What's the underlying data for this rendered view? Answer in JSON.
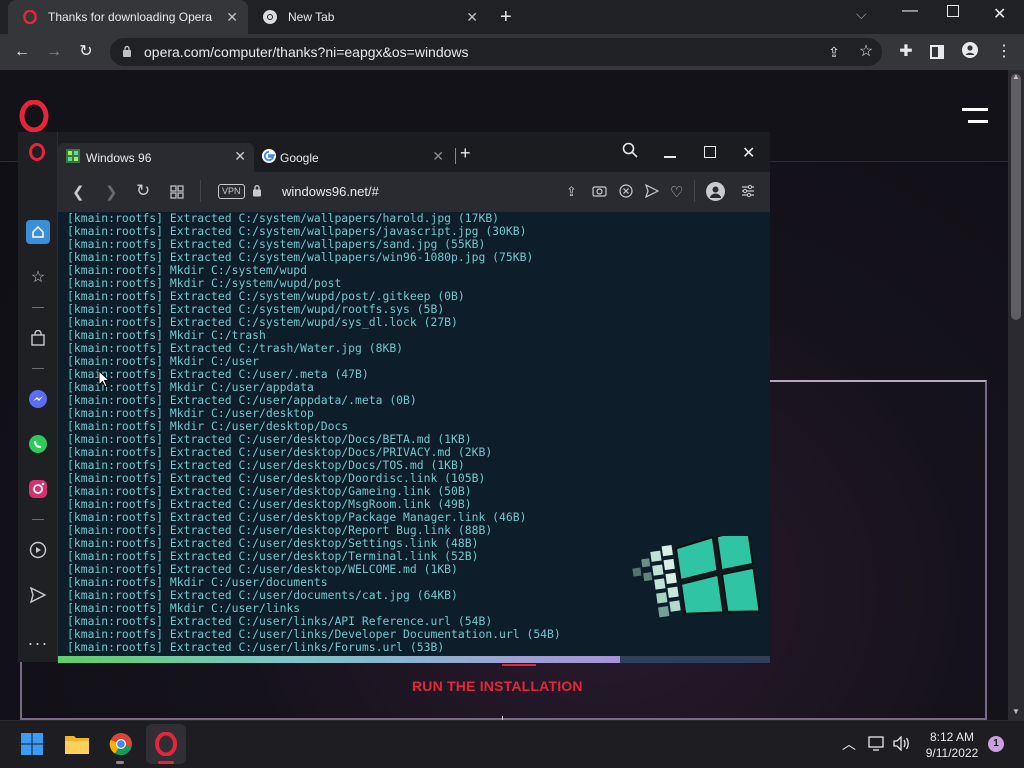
{
  "browser": {
    "tabs": [
      {
        "title": "Thanks for downloading Opera",
        "icon": "opera-icon",
        "active": true
      },
      {
        "title": "New Tab",
        "icon": "chrome-icon",
        "active": false
      }
    ],
    "new_tab_symbol": "+",
    "url": "opera.com/computer/thanks?ni=eapgx&os=windows",
    "window_controls": [
      "minimize",
      "restore",
      "close"
    ]
  },
  "page": {
    "run_label": "RUN THE INSTALLATION"
  },
  "opera": {
    "tabs": [
      {
        "title": "Windows 96",
        "icon": "windows96-icon"
      },
      {
        "title": "Google",
        "icon": "google-icon"
      }
    ],
    "vpn_label": "VPN",
    "url": "windows96.net/#",
    "progress": 0.79
  },
  "terminal": {
    "lines": [
      "[kmain:rootfs] Extracted C:/system/wallpapers/harold.jpg (17KB)",
      "[kmain:rootfs] Extracted C:/system/wallpapers/javascript.jpg (30KB)",
      "[kmain:rootfs] Extracted C:/system/wallpapers/sand.jpg (55KB)",
      "[kmain:rootfs] Extracted C:/system/wallpapers/win96-1080p.jpg (75KB)",
      "[kmain:rootfs] Mkdir C:/system/wupd",
      "[kmain:rootfs] Mkdir C:/system/wupd/post",
      "[kmain:rootfs] Extracted C:/system/wupd/post/.gitkeep (0B)",
      "[kmain:rootfs] Extracted C:/system/wupd/rootfs.sys (5B)",
      "[kmain:rootfs] Extracted C:/system/wupd/sys_dl.lock (27B)",
      "[kmain:rootfs] Mkdir C:/trash",
      "[kmain:rootfs] Extracted C:/trash/Water.jpg (8KB)",
      "[kmain:rootfs] Mkdir C:/user",
      "[kmain:rootfs] Extracted C:/user/.meta (47B)",
      "[kmain:rootfs] Mkdir C:/user/appdata",
      "[kmain:rootfs] Extracted C:/user/appdata/.meta (0B)",
      "[kmain:rootfs] Mkdir C:/user/desktop",
      "[kmain:rootfs] Mkdir C:/user/desktop/Docs",
      "[kmain:rootfs] Extracted C:/user/desktop/Docs/BETA.md (1KB)",
      "[kmain:rootfs] Extracted C:/user/desktop/Docs/PRIVACY.md (2KB)",
      "[kmain:rootfs] Extracted C:/user/desktop/Docs/TOS.md (1KB)",
      "[kmain:rootfs] Extracted C:/user/desktop/Doordisc.link (105B)",
      "[kmain:rootfs] Extracted C:/user/desktop/Gameing.link (50B)",
      "[kmain:rootfs] Extracted C:/user/desktop/MsgRoom.link (49B)",
      "[kmain:rootfs] Extracted C:/user/desktop/Package Manager.link (46B)",
      "[kmain:rootfs] Extracted C:/user/desktop/Report Bug.link (88B)",
      "[kmain:rootfs] Extracted C:/user/desktop/Settings.link (48B)",
      "[kmain:rootfs] Extracted C:/user/desktop/Terminal.link (52B)",
      "[kmain:rootfs] Extracted C:/user/desktop/WELCOME.md (1KB)",
      "[kmain:rootfs] Mkdir C:/user/documents",
      "[kmain:rootfs] Extracted C:/user/documents/cat.jpg (64KB)",
      "[kmain:rootfs] Mkdir C:/user/links",
      "[kmain:rootfs] Extracted C:/user/links/API Reference.url (54B)",
      "[kmain:rootfs] Extracted C:/user/links/Developer Documentation.url (54B)",
      "[kmain:rootfs] Extracted C:/user/links/Forums.url (53B)"
    ]
  },
  "taskbar": {
    "time": "8:12 AM",
    "date": "9/11/2022",
    "notification_count": "1",
    "apps": [
      "windows-start-icon",
      "file-explorer-icon",
      "chrome-icon",
      "opera-icon"
    ]
  },
  "colors": {
    "opera_red": "#e5253a",
    "terminal_text": "#6fc9cf",
    "terminal_bg": "#0d1d29"
  }
}
